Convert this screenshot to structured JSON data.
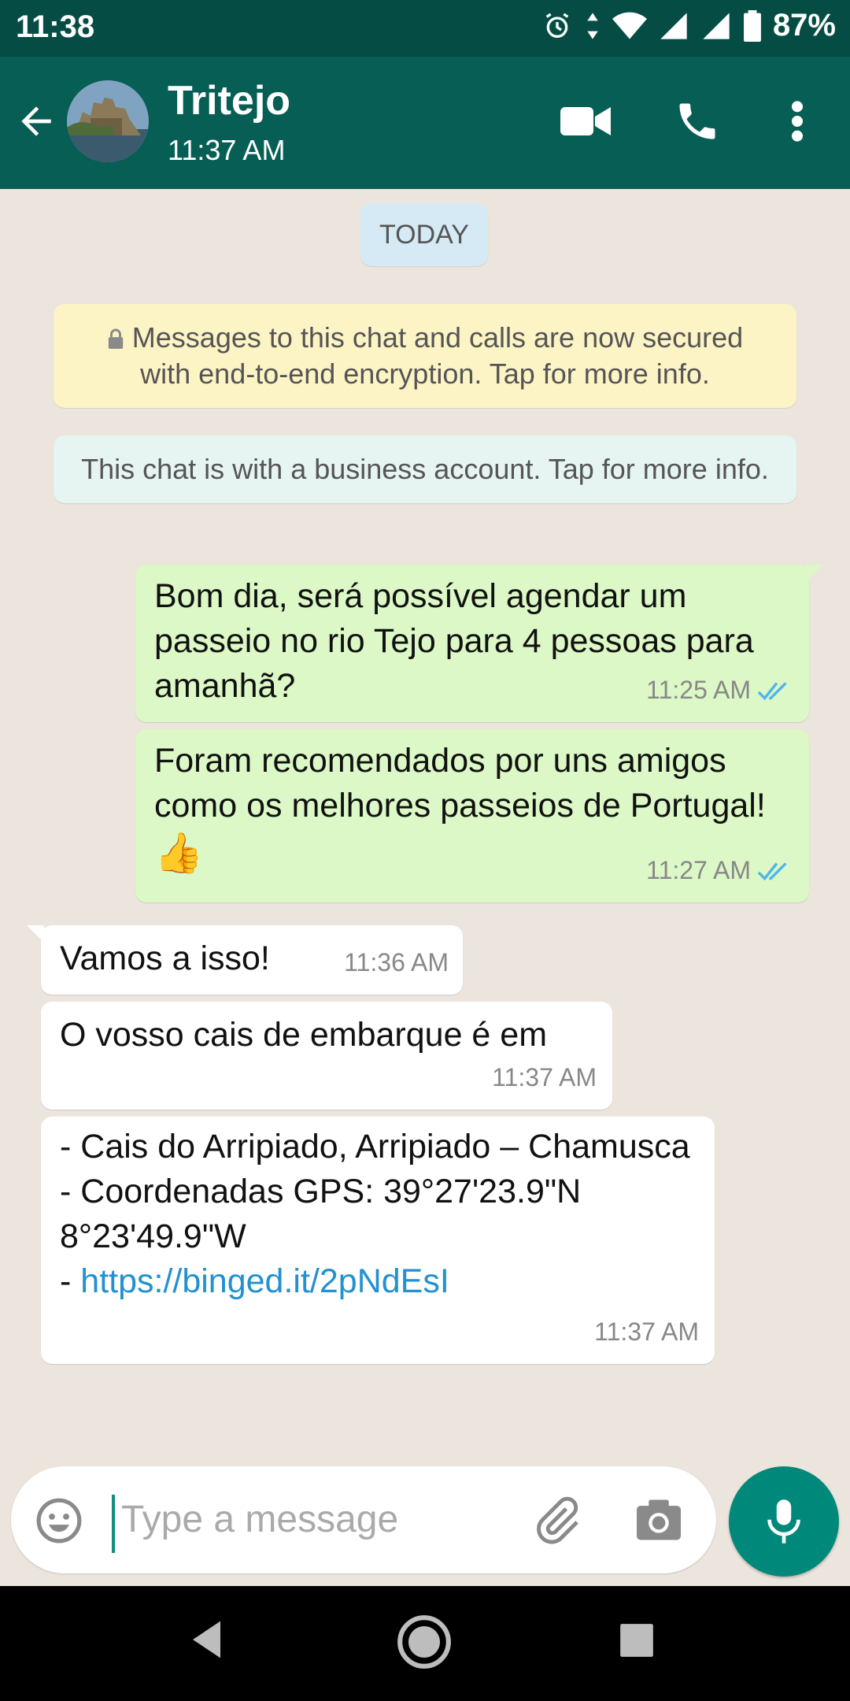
{
  "status_bar": {
    "time": "11:38",
    "battery": "87%"
  },
  "header": {
    "contact_name": "Tritejo",
    "last_seen": "11:37 AM"
  },
  "chat": {
    "date_chip": "TODAY",
    "encryption_notice": "Messages to this chat and calls are now secured with end-to-end encryption. Tap for more info.",
    "business_notice": "This chat is with a business account. Tap for more info.",
    "messages": [
      {
        "direction": "outgoing",
        "text": "Bom dia, será possível agendar um passeio no rio Tejo para 4 pessoas para amanhã?",
        "time": "11:25 AM",
        "status": "read"
      },
      {
        "direction": "outgoing",
        "text": "Foram recomendados por uns amigos como os melhores passeios de Portugal!",
        "emoji": "👍",
        "time": "11:27 AM",
        "status": "read"
      },
      {
        "direction": "incoming",
        "text": "Vamos a isso!",
        "time": "11:36 AM"
      },
      {
        "direction": "incoming",
        "text": "O vosso cais de embarque é em",
        "time": "11:37 AM"
      },
      {
        "direction": "incoming",
        "lines": [
          "- Cais do Arripiado, Arripiado – Chamusca",
          "- Coordenadas GPS: 39°27'23.9\"N 8°23'49.9\"W"
        ],
        "link_prefix": "- ",
        "link": "https://binged.it/2pNdEsI",
        "time": "11:37 AM"
      }
    ]
  },
  "composer": {
    "placeholder": "Type a message"
  },
  "colors": {
    "header": "#075e54",
    "status_bar": "#054d44",
    "outgoing_bubble": "#dcf8c6",
    "incoming_bubble": "#ffffff",
    "accent": "#00897b",
    "link": "#2291d0",
    "read_ticks": "#4fb6ec"
  }
}
